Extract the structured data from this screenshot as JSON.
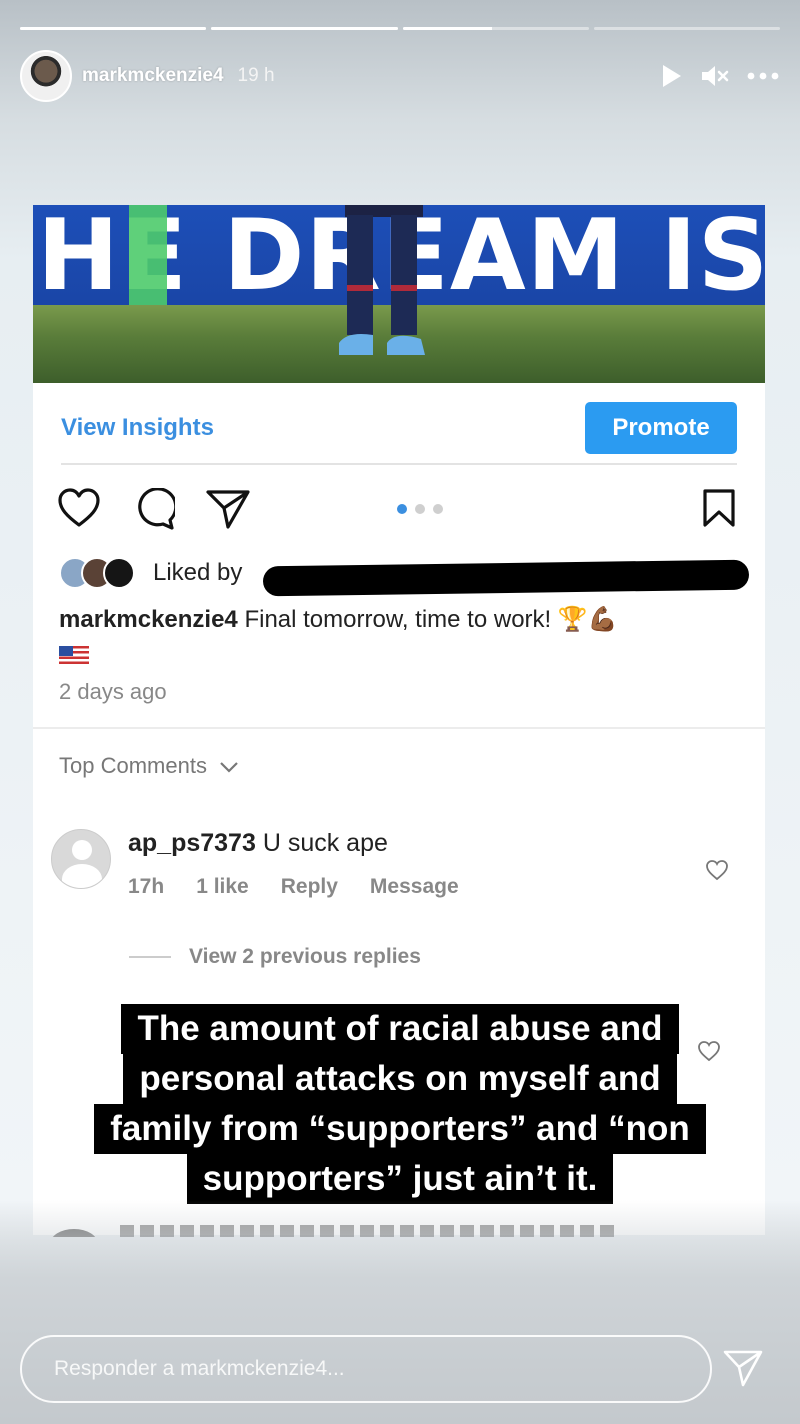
{
  "story": {
    "progress": [
      1.0,
      1.0,
      0.48,
      0.0
    ],
    "username": "markmckenzie4",
    "time": "19 h"
  },
  "post": {
    "banner_text": "HE DREAM IS",
    "view_insights": "View Insights",
    "promote": "Promote",
    "carousel_index": 1,
    "carousel_count": 3,
    "liked_by": "Liked by",
    "caption_user": "markmckenzie4",
    "caption_text": "Final tomorrow, time to work! 🏆💪🏾",
    "posted_ago": "2 days ago",
    "top_comments": "Top Comments"
  },
  "comment": {
    "user": "ap_ps7373",
    "text": "U suck ape",
    "age": "17h",
    "likes": "1 like",
    "reply": "Reply",
    "message": "Message",
    "view_replies": "View 2 previous replies"
  },
  "overlay": {
    "lines": [
      "The amount of racial abuse and",
      "personal attacks on myself and",
      "family from “supporters” and “non",
      "supporters” just ain’t it."
    ]
  },
  "reply_bar": {
    "placeholder": "Responder a markmckenzie4..."
  },
  "colors": {
    "accent_blue": "#3b8fe0",
    "promote_bg": "#2b9bf1"
  }
}
